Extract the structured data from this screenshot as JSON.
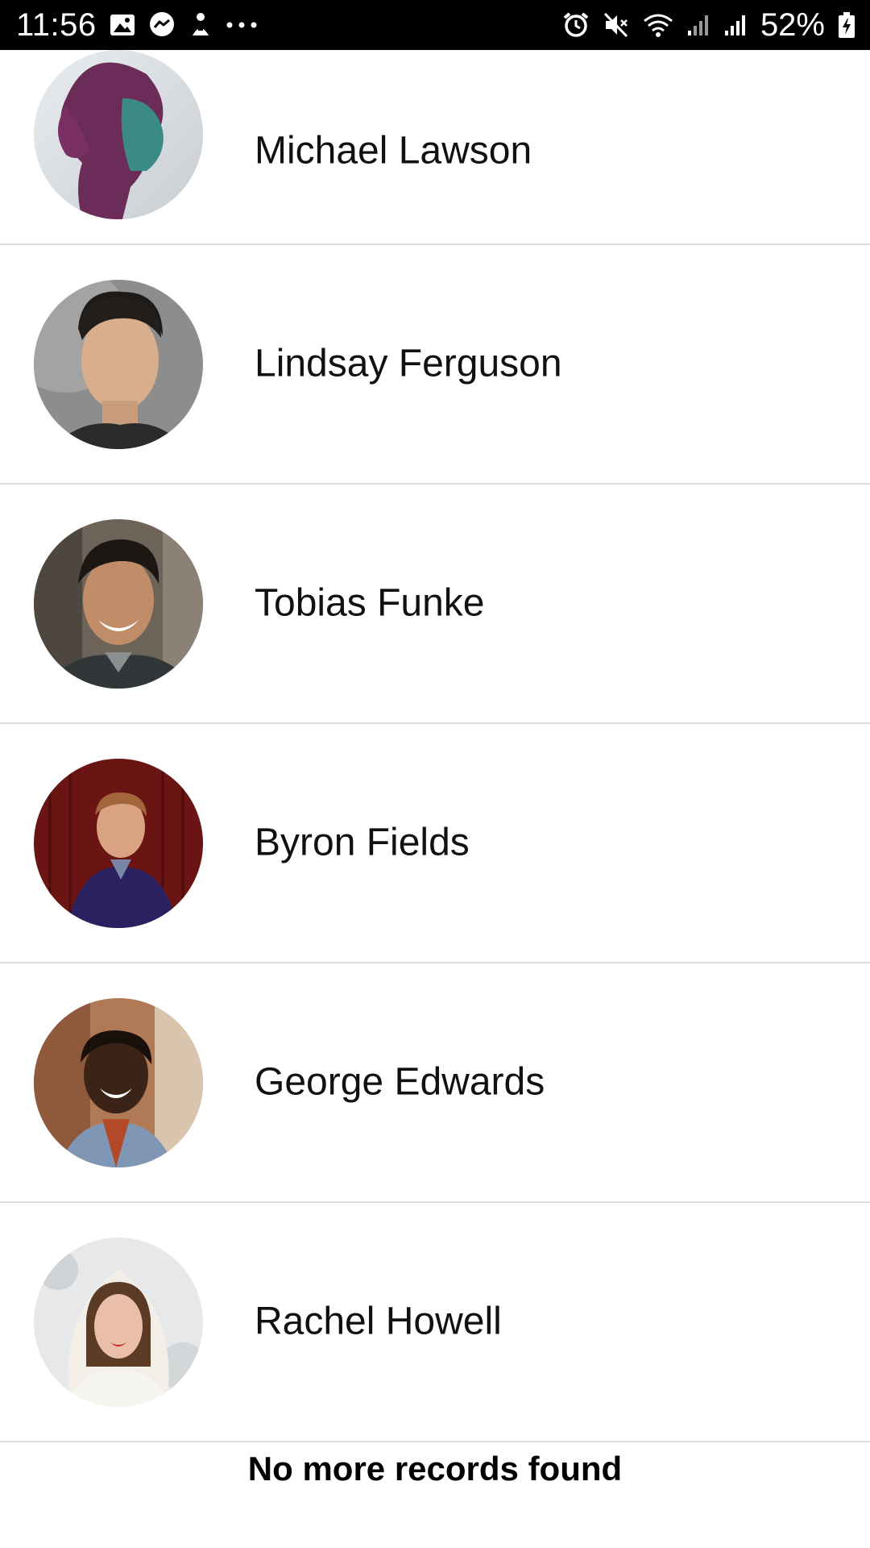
{
  "status_bar": {
    "time": "11:56",
    "left_icons": [
      "gallery-icon",
      "messenger-icon",
      "upload-icon",
      "more-dots-icon"
    ],
    "right_icons": [
      "alarm-icon",
      "mute-icon",
      "wifi-icon",
      "signal-icon",
      "signal-icon",
      "battery-charging-icon"
    ],
    "battery": "52%",
    "overflow_dots": "···"
  },
  "contacts": [
    {
      "name": "Michael Lawson",
      "avatar": "avatar-photo"
    },
    {
      "name": "Lindsay Ferguson",
      "avatar": "avatar-photo"
    },
    {
      "name": "Tobias Funke",
      "avatar": "avatar-photo"
    },
    {
      "name": "Byron Fields",
      "avatar": "avatar-photo"
    },
    {
      "name": "George Edwards",
      "avatar": "avatar-photo"
    },
    {
      "name": "Rachel Howell",
      "avatar": "avatar-photo"
    }
  ],
  "footer": {
    "message": "No more records found"
  },
  "colors": {
    "status_bar_bg": "#000000",
    "divider": "#dcdcdc",
    "text": "#111111",
    "background": "#ffffff"
  }
}
